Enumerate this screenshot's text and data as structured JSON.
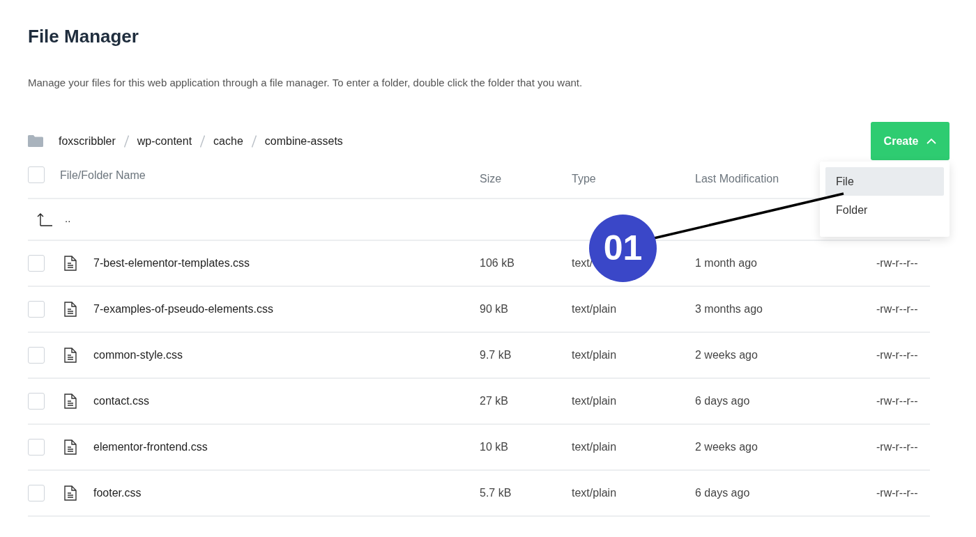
{
  "title": "File Manager",
  "description": "Manage your files for this web application through a file manager. To enter a folder, double click the folder that you want.",
  "breadcrumb": [
    "foxscribbler",
    "wp-content",
    "cache",
    "combine-assets"
  ],
  "create_button": {
    "label": "Create",
    "expanded": true
  },
  "create_menu": [
    {
      "label": "File",
      "selected": true
    },
    {
      "label": "Folder",
      "selected": false
    }
  ],
  "table": {
    "select_all_checked": false,
    "columns": [
      "File/Folder Name",
      "Size",
      "Type",
      "Last Modification"
    ],
    "parent_row": {
      "label": ".."
    },
    "rows": [
      {
        "name": "7-best-elementor-templates.css",
        "size": "106 kB",
        "type": "text/",
        "modified": "1 month ago",
        "permissions": "-rw-r--r--",
        "checked": false
      },
      {
        "name": "7-examples-of-pseudo-elements.css",
        "size": "90 kB",
        "type": "text/plain",
        "modified": "3 months ago",
        "permissions": "-rw-r--r--",
        "checked": false
      },
      {
        "name": "common-style.css",
        "size": "9.7 kB",
        "type": "text/plain",
        "modified": "2 weeks ago",
        "permissions": "-rw-r--r--",
        "checked": false
      },
      {
        "name": "contact.css",
        "size": "27 kB",
        "type": "text/plain",
        "modified": "6 days ago",
        "permissions": "-rw-r--r--",
        "checked": false
      },
      {
        "name": "elementor-frontend.css",
        "size": "10 kB",
        "type": "text/plain",
        "modified": "2 weeks ago",
        "permissions": "-rw-r--r--",
        "checked": false
      },
      {
        "name": "footer.css",
        "size": "5.7 kB",
        "type": "text/plain",
        "modified": "6 days ago",
        "permissions": "-rw-r--r--",
        "checked": false
      }
    ]
  },
  "annotation": {
    "label": "01"
  }
}
